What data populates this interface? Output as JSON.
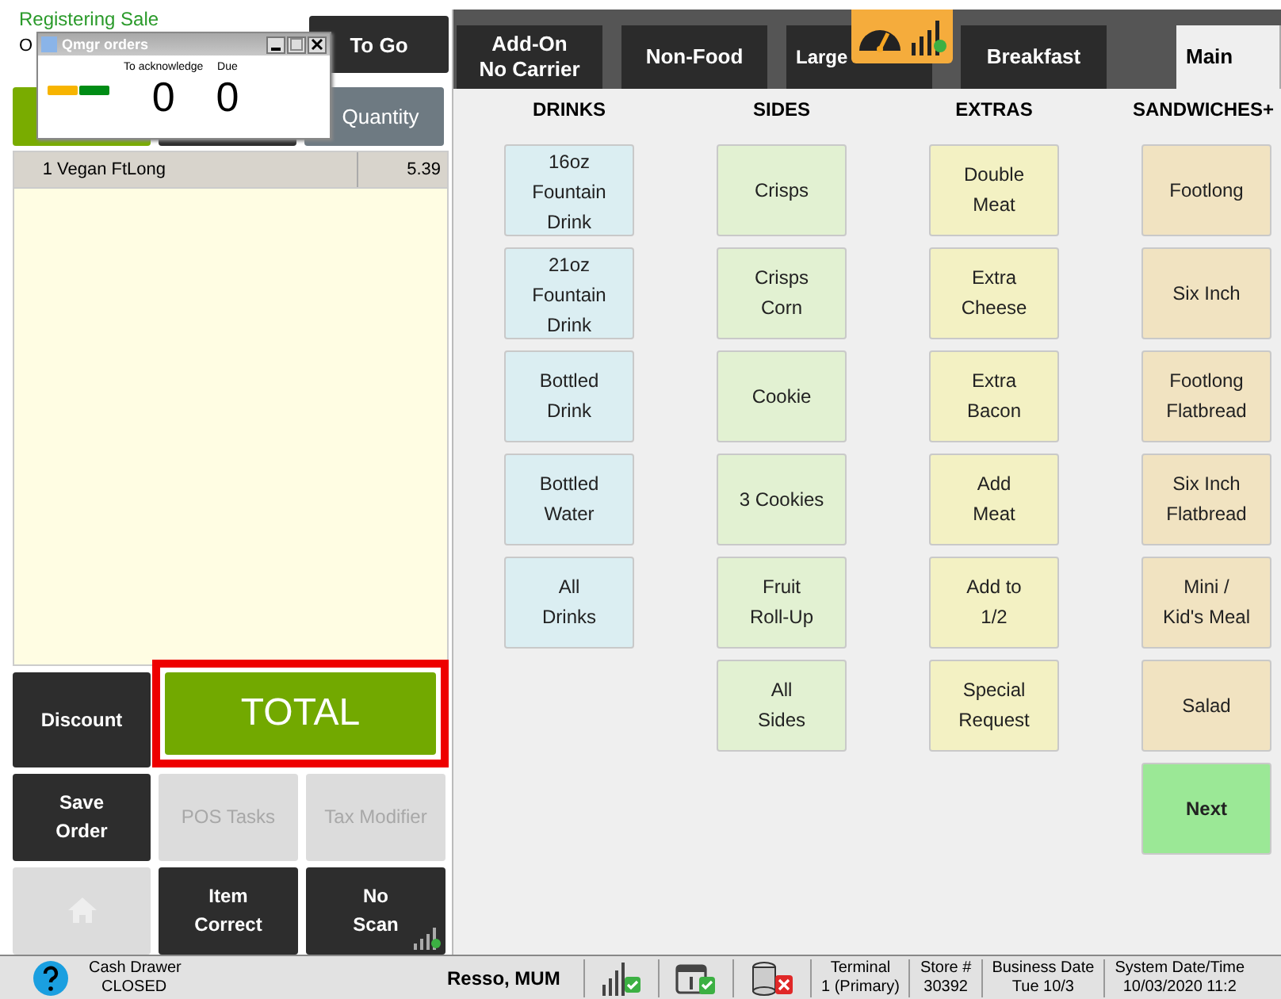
{
  "header": {
    "title": "Registering Sale",
    "subtitle": "O"
  },
  "top_buttons": [
    {
      "label": "To Go",
      "kind": "dark"
    }
  ],
  "mode_buttons": [
    {
      "kind": "green"
    },
    {
      "kind": "dark"
    },
    {
      "label": "Quantity",
      "kind": "gray"
    }
  ],
  "qmgr_window": {
    "title": "Qmgr orders",
    "counters": [
      {
        "label": "To acknowledge",
        "value": "0"
      },
      {
        "label": "Due",
        "value": "0"
      }
    ]
  },
  "order_items": [
    {
      "qty": "1",
      "name": "Vegan FtLong",
      "price": "5.39",
      "selected": true
    }
  ],
  "action_buttons": [
    {
      "label": "Discount",
      "kind": "dark",
      "disabled": false
    },
    {
      "label": "TOTAL",
      "kind": "total",
      "disabled": false
    },
    {
      "label": "Save\nOrder",
      "kind": "dark",
      "disabled": false
    },
    {
      "label": "POS Tasks",
      "kind": "dark",
      "disabled": true
    },
    {
      "label": "Tax Modifier",
      "kind": "dark",
      "disabled": true
    },
    {
      "kind": "home",
      "disabled": true
    },
    {
      "label": "Item\nCorrect",
      "kind": "dark",
      "disabled": false
    },
    {
      "label": "No\nScan",
      "kind": "signal",
      "disabled": false
    }
  ],
  "tabs": [
    {
      "label": "Add-On\nNo Carrier",
      "selected": false
    },
    {
      "label": "Non-Food",
      "selected": false
    },
    {
      "label": "Large",
      "selected": false
    },
    {
      "label": "Breakfast",
      "selected": false
    },
    {
      "label": "Main",
      "selected": true
    }
  ],
  "columns": [
    {
      "heading": "DRINKS",
      "color": "#dbeef2",
      "items": [
        "16oz\nFountain\nDrink",
        "21oz\nFountain\nDrink",
        "Bottled\nDrink",
        "Bottled\nWater",
        "All\nDrinks"
      ]
    },
    {
      "heading": "SIDES",
      "color": "#e2f1d2",
      "items": [
        "Crisps",
        "Crisps\nCorn",
        "Cookie",
        "3 Cookies",
        "Fruit\nRoll-Up",
        "All\nSides"
      ]
    },
    {
      "heading": "EXTRAS",
      "color": "#f3f1c3",
      "items": [
        "Double\nMeat",
        "Extra\nCheese",
        "Extra\nBacon",
        "Add\nMeat",
        "Add to\n1/2",
        "Special\nRequest"
      ]
    },
    {
      "heading": "SANDWICHES+",
      "color": "#f1e3c1",
      "items": [
        "Footlong",
        "Six Inch",
        "Footlong\nFlatbread",
        "Six Inch\nFlatbread",
        "Mini /\nKid's Meal",
        "Salad"
      ]
    }
  ],
  "next_button": {
    "label": "Next"
  },
  "status_bar": {
    "cash_drawer": "Cash Drawer",
    "drawer_state": "CLOSED",
    "user": "Resso, MUM",
    "fields": [
      {
        "label": "Terminal",
        "value": "1 (Primary)"
      },
      {
        "label": "Store #",
        "value": "30392"
      },
      {
        "label": "Business Date",
        "value": "Tue 10/3"
      },
      {
        "label": "System Date/Time",
        "value": "10/03/2020 11:2"
      }
    ]
  }
}
